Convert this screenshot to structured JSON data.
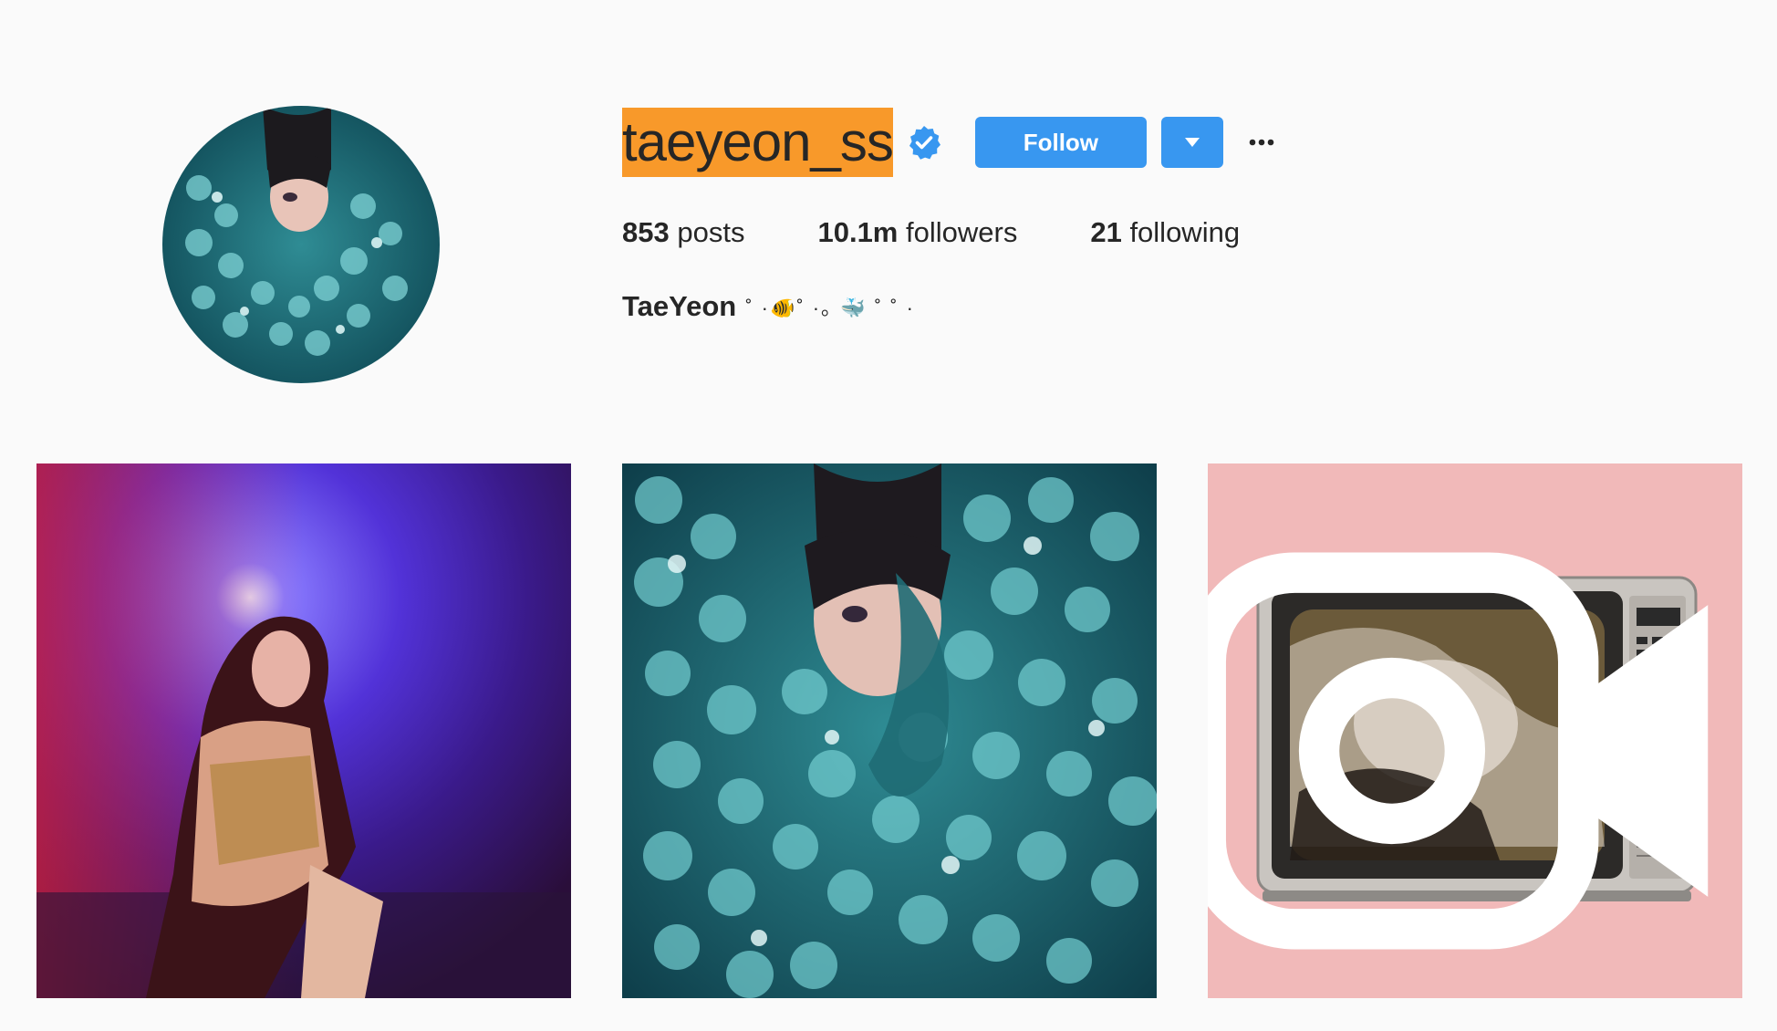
{
  "profile": {
    "username": "taeyeon_ss",
    "verified": true,
    "follow_label": "Follow",
    "dropdown_icon": "caret-down-icon",
    "more_icon": "more-options-icon",
    "stats": {
      "posts_count": "853",
      "posts_label": "posts",
      "followers_count": "10.1m",
      "followers_label": "followers",
      "following_count": "21",
      "following_label": "following"
    },
    "bio": {
      "name": "TaeYeon",
      "decoration": "˚  ·🐠˚  ·｡ 🐳   ˚  ˚  ·"
    }
  },
  "colors": {
    "accent": "#3897f0",
    "username_highlight": "#f8992a",
    "background": "#fafafa"
  },
  "posts": [
    {
      "type": "image"
    },
    {
      "type": "image"
    },
    {
      "type": "video",
      "badge_icon": "video-camera-icon"
    }
  ]
}
